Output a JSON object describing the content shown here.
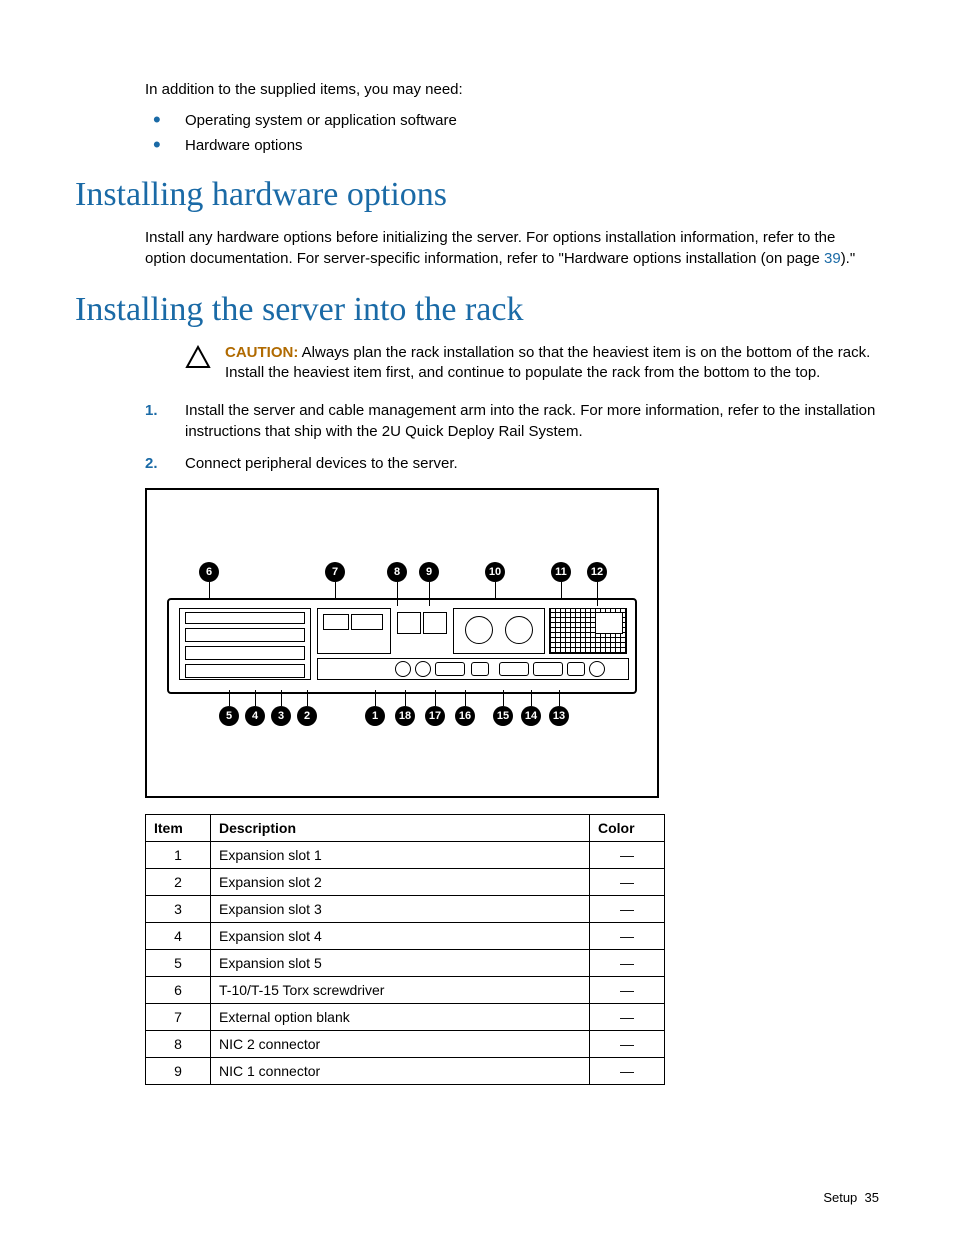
{
  "intro": {
    "lead": "In addition to the supplied items, you may need:",
    "bullets": [
      "Operating system or application software",
      "Hardware options"
    ]
  },
  "section_hw": {
    "title": "Installing hardware options",
    "para_a": "Install any hardware options before initializing the server. For options installation information, refer to the option documentation. For server-specific information, refer to \"Hardware options installation (on page ",
    "link": "39",
    "para_b": ").\""
  },
  "section_rack": {
    "title": "Installing the server into the rack",
    "caution_label": "CAUTION:",
    "caution_text": " Always plan the rack installation so that the heaviest item is on the bottom of the rack. Install the heaviest item first, and continue to populate the rack from the bottom to the top.",
    "steps": [
      "Install the server and cable management arm into the rack. For more information, refer to the installation instructions that ship with the 2U Quick Deploy Rail System.",
      "Connect peripheral devices to the server."
    ]
  },
  "callouts_top": [
    "6",
    "7",
    "8",
    "9",
    "10",
    "11",
    "12"
  ],
  "callouts_bottom": [
    "5",
    "4",
    "3",
    "2",
    "1",
    "18",
    "17",
    "16",
    "15",
    "14",
    "13"
  ],
  "table": {
    "headers": {
      "item": "Item",
      "desc": "Description",
      "color": "Color"
    },
    "rows": [
      {
        "item": "1",
        "desc": "Expansion slot 1",
        "color": "—"
      },
      {
        "item": "2",
        "desc": "Expansion slot 2",
        "color": "—"
      },
      {
        "item": "3",
        "desc": "Expansion slot 3",
        "color": "—"
      },
      {
        "item": "4",
        "desc": "Expansion slot 4",
        "color": "—"
      },
      {
        "item": "5",
        "desc": "Expansion slot 5",
        "color": "—"
      },
      {
        "item": "6",
        "desc": "T-10/T-15 Torx screwdriver",
        "color": "—"
      },
      {
        "item": "7",
        "desc": "External option blank",
        "color": "—"
      },
      {
        "item": "8",
        "desc": "NIC 2 connector",
        "color": "—"
      },
      {
        "item": "9",
        "desc": "NIC 1 connector",
        "color": "—"
      }
    ]
  },
  "footer": {
    "section": "Setup",
    "page": "35"
  }
}
